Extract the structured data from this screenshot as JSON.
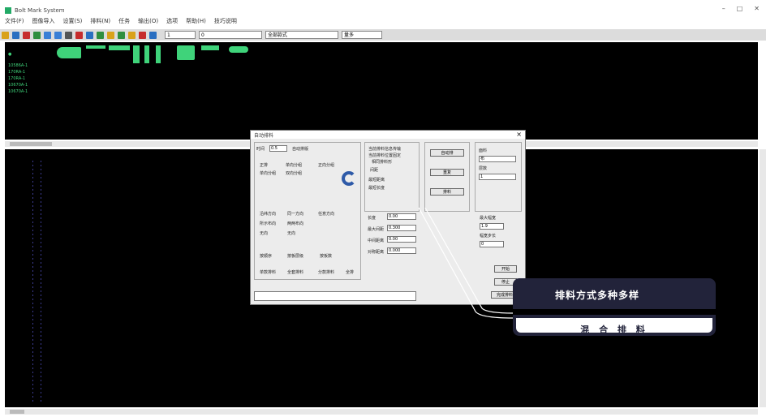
{
  "window": {
    "title": "Bolt Mark System",
    "controls": [
      "–",
      "□",
      "✕"
    ]
  },
  "menu": {
    "items": [
      "文件(F)",
      "图像导入",
      "设置(S)",
      "排料(N)",
      "任务",
      "输出(O)",
      "选项",
      "帮助(H)",
      "技巧说明"
    ]
  },
  "toolbar": {
    "icons": [
      {
        "name": "open-icon",
        "color": "#d9a21b"
      },
      {
        "name": "save-icon",
        "color": "#2a6fc1"
      },
      {
        "name": "print-icon",
        "color": "#c62c2c"
      },
      {
        "name": "grid-icon",
        "color": "#2f8e3f"
      },
      {
        "name": "undo-icon",
        "color": "#3a7fd6"
      },
      {
        "name": "redo-icon",
        "color": "#3a7fd6"
      },
      {
        "name": "zoom-icon",
        "color": "#555555"
      },
      {
        "name": "measure-icon",
        "color": "#c62c2c"
      },
      {
        "name": "layout-icon",
        "color": "#2a6fc1"
      },
      {
        "name": "rotate-icon",
        "color": "#2f8e3f"
      },
      {
        "name": "mirror-icon",
        "color": "#d9a21b"
      },
      {
        "name": "nest-icon",
        "color": "#2f8e3f"
      },
      {
        "name": "text-icon",
        "color": "#d9a21b"
      },
      {
        "name": "color-icon",
        "color": "#c62c2c"
      },
      {
        "name": "help-icon",
        "color": "#2a6fc1"
      }
    ],
    "combos": [
      "1",
      "0",
      "全部款式",
      "量多"
    ]
  },
  "top_pane": {
    "rows": [
      {
        "label": "10586A-1"
      },
      {
        "label": "170RA-1"
      },
      {
        "label": "170RA-1"
      },
      {
        "label": "10670A-1"
      },
      {
        "label": "10670A-1"
      }
    ]
  },
  "dialog": {
    "title": "自动排料",
    "left_group": {
      "fields": [
        {
          "label": "时间",
          "value": "0.5"
        },
        {
          "label": "自动排版",
          "value": ""
        }
      ],
      "options_a": [
        "正排",
        "单向分组",
        "正向分组",
        "单向分组",
        "双向分组"
      ],
      "options_b": [
        "沿纬方向",
        "同一方向",
        "任意方向",
        "所示布向",
        "两两布向",
        "无向",
        "无向"
      ],
      "options_c": [
        "按顺序",
        "按板层级",
        "按板数"
      ],
      "options_d": [
        "单款排料",
        "全套排料",
        "分款排料",
        "全排"
      ]
    },
    "middle_group": {
      "options": [
        "当前排料信息传输",
        "当前排料位置固定",
        "相同排料形",
        "间距",
        "最短距离",
        "最短长度"
      ],
      "fields": [
        {
          "label": "间距",
          "value": "0"
        },
        {
          "label": "长度",
          "value": "0.00"
        },
        {
          "label": "最大间距",
          "value": "0.300"
        },
        {
          "label": "中间距离",
          "value": "0.00"
        },
        {
          "label": "对称距离",
          "value": "0.000"
        }
      ]
    },
    "right_group": {
      "buttons": [
        "自动排",
        "重复",
        "排料",
        "开始",
        "停止",
        "完成排料"
      ],
      "fields": [
        {
          "label": "面料",
          "value": "布"
        },
        {
          "label": "层数",
          "value": "1"
        },
        {
          "label": "最大幅宽",
          "value": "1.9"
        },
        {
          "label": "幅宽步长",
          "value": "0"
        }
      ]
    }
  },
  "banners": {
    "top": "排料方式多种多样",
    "bottom": "混 合 排 料"
  },
  "colors": {
    "canvas": "#000000",
    "piece": "#3fd37a",
    "banner_bg": "#22233a",
    "spinner": "#2e5aa8"
  }
}
